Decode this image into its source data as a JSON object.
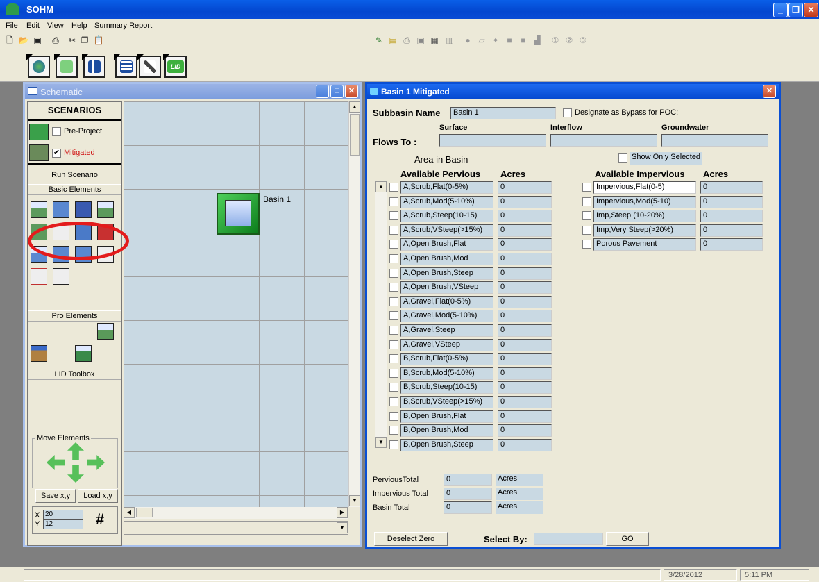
{
  "app": {
    "title": "SOHM",
    "menu": [
      "File",
      "Edit",
      "View",
      "Help",
      "Summary Report"
    ]
  },
  "toolbar": {
    "std_icons": [
      "new-icon",
      "open-icon",
      "save-icon",
      "print-icon",
      "cut-icon",
      "copy-icon",
      "paste-icon"
    ],
    "right_icons": [
      "edit-icon",
      "clipboard-icon",
      "print-icon",
      "save-icon",
      "table-icon",
      "grid-icon",
      "circle-icon",
      "folder-icon",
      "run-icon",
      "square-icon",
      "square-icon",
      "chart-icon"
    ],
    "circled_labels": [
      "①",
      "②",
      "③"
    ],
    "big_buttons": [
      "globe-icon",
      "wave-icon",
      "bar-chart-icon",
      "report-icon",
      "tools-icon",
      "lid-icon"
    ],
    "lid_label": "LID"
  },
  "schematic": {
    "title": "Schematic",
    "scenarios_header": "SCENARIOS",
    "scenarios": [
      {
        "label": "Pre-Project",
        "checked": false
      },
      {
        "label": "Mitigated",
        "checked": true
      }
    ],
    "run_scenario": "Run Scenario",
    "basic_elements": "Basic Elements",
    "pro_elements": "Pro Elements",
    "lid_toolbox": "LID Toolbox",
    "move_elements": "Move Elements",
    "save_xy": "Save x,y",
    "load_xy": "Load x,y",
    "x_label": "X",
    "y_label": "Y",
    "x_value": "20",
    "y_value": "12",
    "grid_symbol": "#",
    "basin_label": "Basin 1"
  },
  "basin": {
    "title": "Basin  1 Mitigated",
    "subbasin_name_label": "Subbasin Name",
    "subbasin_name": "Basin 1",
    "bypass_label": "Designate as Bypass for POC:",
    "flows_to_label": "Flows To :",
    "surface": "Surface",
    "interflow": "Interflow",
    "groundwater": "Groundwater",
    "area_in_basin": "Area in Basin",
    "show_only_selected": "Show Only Selected",
    "available_pervious": "Available Pervious",
    "available_impervious": "Available Impervious",
    "acres": "Acres",
    "pervious": [
      {
        "name": "A,Scrub,Flat(0-5%)",
        "value": "0"
      },
      {
        "name": "A,Scrub,Mod(5-10%)",
        "value": "0"
      },
      {
        "name": "A,Scrub,Steep(10-15)",
        "value": "0"
      },
      {
        "name": "A,Scrub,VSteep(>15%)",
        "value": "0"
      },
      {
        "name": "A,Open Brush,Flat",
        "value": "0"
      },
      {
        "name": "A,Open Brush,Mod",
        "value": "0"
      },
      {
        "name": "A,Open Brush,Steep",
        "value": "0"
      },
      {
        "name": "A,Open Brush,VSteep",
        "value": "0"
      },
      {
        "name": "A,Gravel,Flat(0-5%)",
        "value": "0"
      },
      {
        "name": "A,Gravel,Mod(5-10%)",
        "value": "0"
      },
      {
        "name": "A,Gravel,Steep",
        "value": "0"
      },
      {
        "name": "A,Gravel,VSteep",
        "value": "0"
      },
      {
        "name": "B,Scrub,Flat(0-5%)",
        "value": "0"
      },
      {
        "name": "B,Scrub,Mod(5-10%)",
        "value": "0"
      },
      {
        "name": "B,Scrub,Steep(10-15)",
        "value": "0"
      },
      {
        "name": "B,Scrub,VSteep(>15%)",
        "value": "0"
      },
      {
        "name": "B,Open Brush,Flat",
        "value": "0"
      },
      {
        "name": "B,Open Brush,Mod",
        "value": "0"
      },
      {
        "name": "B,Open Brush,Steep",
        "value": "0"
      }
    ],
    "impervious": [
      {
        "name": "Impervious,Flat(0-5)",
        "value": "0"
      },
      {
        "name": "Impervious,Mod(5-10)",
        "value": "0"
      },
      {
        "name": "Imp,Steep (10-20%)",
        "value": "0"
      },
      {
        "name": "Imp,Very Steep(>20%)",
        "value": "0"
      },
      {
        "name": "Porous Pavement",
        "value": "0"
      }
    ],
    "pervious_total_label": "PerviousTotal",
    "impervious_total_label": "Impervious Total",
    "basin_total_label": "Basin Total",
    "pervious_total": "0",
    "impervious_total": "0",
    "basin_total": "0",
    "deselect_zero": "Deselect Zero",
    "select_by": "Select By:",
    "go": "GO"
  },
  "status": {
    "date": "3/28/2012",
    "time": "5:11 PM"
  },
  "colors": {
    "xp_blue": "#0a4fd4",
    "field_bg": "#c9d9e3",
    "annotation_red": "#e31b1b"
  }
}
